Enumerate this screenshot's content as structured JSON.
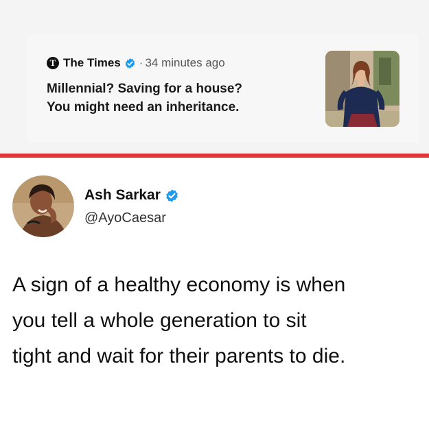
{
  "news": {
    "source_logo_letter": "T",
    "source_name": "The Times",
    "separator": "·",
    "time_ago": "34 minutes ago",
    "headline": "Millennial? Saving for a house?\nYou might need an inheritance."
  },
  "tweet": {
    "author_name": "Ash Sarkar",
    "handle": "@AyoCaesar",
    "text": "A sign of a healthy economy is when\nyou tell a whole generation to sit\ntight and wait for their parents to die."
  },
  "colors": {
    "divider_red": "#e23434",
    "verified_blue": "#1d9bf0",
    "top_background": "#f4f4f4"
  },
  "icons": {
    "verified": "verified-badge-icon",
    "times_logo": "times-logo-icon"
  }
}
